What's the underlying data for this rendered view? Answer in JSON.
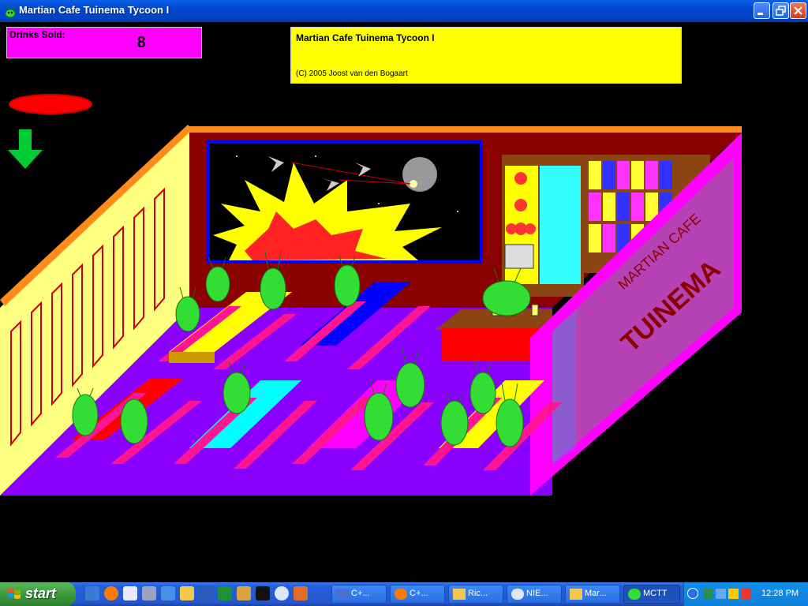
{
  "window": {
    "title": "Martian Cafe Tuinema Tycoon I"
  },
  "hud": {
    "drinks_label": "Drinks Sold:",
    "drinks_value": "8",
    "info_title": "Martian Cafe Tuinema Tycoon I",
    "info_copyright": "(C) 2005 Joost van den Bogaart"
  },
  "scene": {
    "shop_sign_top": "MARTIAN CAFE",
    "shop_sign_bottom": "TUINEMA"
  },
  "taskbar": {
    "start_label": "start",
    "more_label": "»",
    "tasks": [
      {
        "label": "C+...",
        "icon": "ide-icon"
      },
      {
        "label": "C+...",
        "icon": "firefox-icon"
      },
      {
        "label": "Ric...",
        "icon": "folder-icon"
      },
      {
        "label": "NIE...",
        "icon": "cd-icon"
      },
      {
        "label": "Mar...",
        "icon": "folder-icon"
      },
      {
        "label": "MCTT",
        "icon": "martian-icon"
      }
    ],
    "clock": "12:28 PM"
  },
  "colors": {
    "floor": "#8a00ff",
    "back_wall": "#8b0000",
    "side_wall": "#ffff80",
    "counter_frame": "#ff00ff",
    "alien": "#33dd33"
  }
}
